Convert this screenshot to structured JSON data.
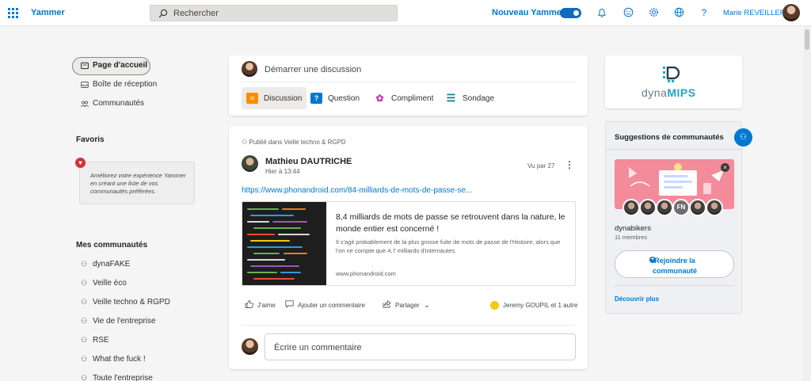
{
  "topbar": {
    "app_name": "Yammer",
    "search_placeholder": "Rechercher",
    "new_yammer_label": "Nouveau Yammer",
    "new_yammer_enabled": true,
    "user_name": "Marie REVEILLERE",
    "icons": [
      "bell-icon",
      "smiley-icon",
      "gear-icon",
      "globe-icon",
      "help-icon"
    ]
  },
  "nav": {
    "items": [
      {
        "label": "Page d'accueil",
        "icon": "home-icon",
        "active": true
      },
      {
        "label": "Boîte de réception",
        "icon": "inbox-icon"
      },
      {
        "label": "Communautés",
        "icon": "communities-icon"
      }
    ],
    "favorites_title": "Favoris",
    "favorites_hint": "Améliorez votre expérience Yammer en créant une liste de vos communautés préférées.",
    "my_communities_title": "Mes communautés",
    "communities": [
      "dynaFAKE",
      "Veille éco",
      "Veille techno & RGPD",
      "Vie de l'entreprise",
      "RSE",
      "What the fuck !",
      "Toute l'entreprise"
    ]
  },
  "composer": {
    "prompt": "Démarrer une discussion",
    "tabs": [
      {
        "label": "Discussion",
        "icon": "discussion-icon",
        "color": "#ff8c00"
      },
      {
        "label": "Question",
        "icon": "question-icon",
        "color": "#0078d4"
      },
      {
        "label": "Compliment",
        "icon": "ribbon-icon",
        "color": "#c239b3"
      },
      {
        "label": "Sondage",
        "icon": "poll-icon",
        "color": "#038387"
      }
    ]
  },
  "post": {
    "published_in": "Publié dans Veille techno & RGPD",
    "author": "Mathieu DAUTRICHE",
    "date": "Hier à 13:44",
    "seen_by": "Vu par 27",
    "more": "⋮",
    "link": "https://www.phonandroid.com/84-milliards-de-mots-de-passe-se...",
    "preview": {
      "title": "8,4 milliards de mots de passe se retrouvent dans la nature, le monde entier est concerné !",
      "description": "Il s'agit probablement de la plus grosse fuite de mots de passe de l'Histoire, alors que l'on ne compte que 4,7 milliards d'internautes.",
      "domain": "www.phonandroid.com"
    },
    "actions": {
      "like": "J'aime",
      "comment": "Ajouter un commentaire",
      "share": "Partager"
    },
    "reactors": "Jeremy GOUPIL et 1 autre",
    "comment_placeholder": "Écrire un commentaire"
  },
  "right": {
    "logo": {
      "part1": "dyna",
      "part2": "MIPS"
    },
    "suggestions": {
      "title": "Suggestions de communautés",
      "community_name": "dynabikers",
      "members_count": "11 membres",
      "member_initials": "FN",
      "join_label": "Rejoindre la communauté",
      "discover_more": "Découvrir plus"
    }
  },
  "colors": {
    "accent": "#0078d4",
    "background": "#f5f5f5"
  }
}
